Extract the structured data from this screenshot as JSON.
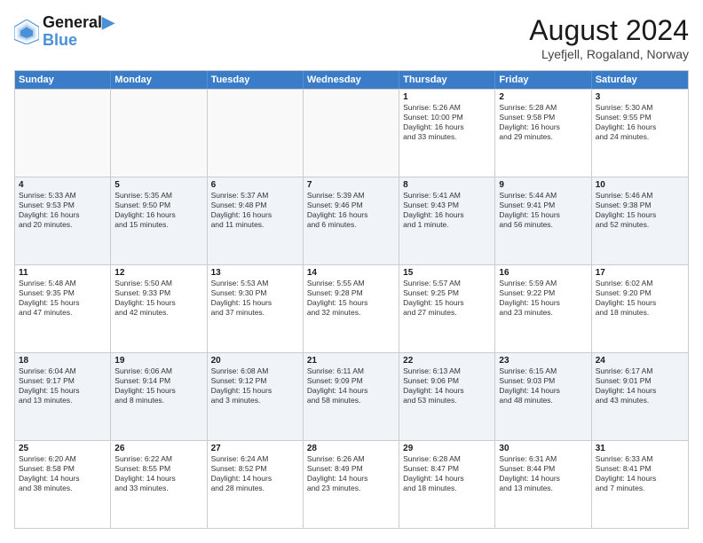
{
  "header": {
    "logo_line1": "General",
    "logo_line2": "Blue",
    "title": "August 2024",
    "subtitle": "Lyefjell, Rogaland, Norway"
  },
  "weekdays": [
    "Sunday",
    "Monday",
    "Tuesday",
    "Wednesday",
    "Thursday",
    "Friday",
    "Saturday"
  ],
  "rows": [
    [
      {
        "day": "",
        "info": "",
        "empty": true
      },
      {
        "day": "",
        "info": "",
        "empty": true
      },
      {
        "day": "",
        "info": "",
        "empty": true
      },
      {
        "day": "",
        "info": "",
        "empty": true
      },
      {
        "day": "1",
        "info": "Sunrise: 5:26 AM\nSunset: 10:00 PM\nDaylight: 16 hours\nand 33 minutes."
      },
      {
        "day": "2",
        "info": "Sunrise: 5:28 AM\nSunset: 9:58 PM\nDaylight: 16 hours\nand 29 minutes."
      },
      {
        "day": "3",
        "info": "Sunrise: 5:30 AM\nSunset: 9:55 PM\nDaylight: 16 hours\nand 24 minutes."
      }
    ],
    [
      {
        "day": "4",
        "info": "Sunrise: 5:33 AM\nSunset: 9:53 PM\nDaylight: 16 hours\nand 20 minutes."
      },
      {
        "day": "5",
        "info": "Sunrise: 5:35 AM\nSunset: 9:50 PM\nDaylight: 16 hours\nand 15 minutes."
      },
      {
        "day": "6",
        "info": "Sunrise: 5:37 AM\nSunset: 9:48 PM\nDaylight: 16 hours\nand 11 minutes."
      },
      {
        "day": "7",
        "info": "Sunrise: 5:39 AM\nSunset: 9:46 PM\nDaylight: 16 hours\nand 6 minutes."
      },
      {
        "day": "8",
        "info": "Sunrise: 5:41 AM\nSunset: 9:43 PM\nDaylight: 16 hours\nand 1 minute."
      },
      {
        "day": "9",
        "info": "Sunrise: 5:44 AM\nSunset: 9:41 PM\nDaylight: 15 hours\nand 56 minutes."
      },
      {
        "day": "10",
        "info": "Sunrise: 5:46 AM\nSunset: 9:38 PM\nDaylight: 15 hours\nand 52 minutes."
      }
    ],
    [
      {
        "day": "11",
        "info": "Sunrise: 5:48 AM\nSunset: 9:35 PM\nDaylight: 15 hours\nand 47 minutes."
      },
      {
        "day": "12",
        "info": "Sunrise: 5:50 AM\nSunset: 9:33 PM\nDaylight: 15 hours\nand 42 minutes."
      },
      {
        "day": "13",
        "info": "Sunrise: 5:53 AM\nSunset: 9:30 PM\nDaylight: 15 hours\nand 37 minutes."
      },
      {
        "day": "14",
        "info": "Sunrise: 5:55 AM\nSunset: 9:28 PM\nDaylight: 15 hours\nand 32 minutes."
      },
      {
        "day": "15",
        "info": "Sunrise: 5:57 AM\nSunset: 9:25 PM\nDaylight: 15 hours\nand 27 minutes."
      },
      {
        "day": "16",
        "info": "Sunrise: 5:59 AM\nSunset: 9:22 PM\nDaylight: 15 hours\nand 23 minutes."
      },
      {
        "day": "17",
        "info": "Sunrise: 6:02 AM\nSunset: 9:20 PM\nDaylight: 15 hours\nand 18 minutes."
      }
    ],
    [
      {
        "day": "18",
        "info": "Sunrise: 6:04 AM\nSunset: 9:17 PM\nDaylight: 15 hours\nand 13 minutes."
      },
      {
        "day": "19",
        "info": "Sunrise: 6:06 AM\nSunset: 9:14 PM\nDaylight: 15 hours\nand 8 minutes."
      },
      {
        "day": "20",
        "info": "Sunrise: 6:08 AM\nSunset: 9:12 PM\nDaylight: 15 hours\nand 3 minutes."
      },
      {
        "day": "21",
        "info": "Sunrise: 6:11 AM\nSunset: 9:09 PM\nDaylight: 14 hours\nand 58 minutes."
      },
      {
        "day": "22",
        "info": "Sunrise: 6:13 AM\nSunset: 9:06 PM\nDaylight: 14 hours\nand 53 minutes."
      },
      {
        "day": "23",
        "info": "Sunrise: 6:15 AM\nSunset: 9:03 PM\nDaylight: 14 hours\nand 48 minutes."
      },
      {
        "day": "24",
        "info": "Sunrise: 6:17 AM\nSunset: 9:01 PM\nDaylight: 14 hours\nand 43 minutes."
      }
    ],
    [
      {
        "day": "25",
        "info": "Sunrise: 6:20 AM\nSunset: 8:58 PM\nDaylight: 14 hours\nand 38 minutes."
      },
      {
        "day": "26",
        "info": "Sunrise: 6:22 AM\nSunset: 8:55 PM\nDaylight: 14 hours\nand 33 minutes."
      },
      {
        "day": "27",
        "info": "Sunrise: 6:24 AM\nSunset: 8:52 PM\nDaylight: 14 hours\nand 28 minutes."
      },
      {
        "day": "28",
        "info": "Sunrise: 6:26 AM\nSunset: 8:49 PM\nDaylight: 14 hours\nand 23 minutes."
      },
      {
        "day": "29",
        "info": "Sunrise: 6:28 AM\nSunset: 8:47 PM\nDaylight: 14 hours\nand 18 minutes."
      },
      {
        "day": "30",
        "info": "Sunrise: 6:31 AM\nSunset: 8:44 PM\nDaylight: 14 hours\nand 13 minutes."
      },
      {
        "day": "31",
        "info": "Sunrise: 6:33 AM\nSunset: 8:41 PM\nDaylight: 14 hours\nand 7 minutes."
      }
    ]
  ]
}
